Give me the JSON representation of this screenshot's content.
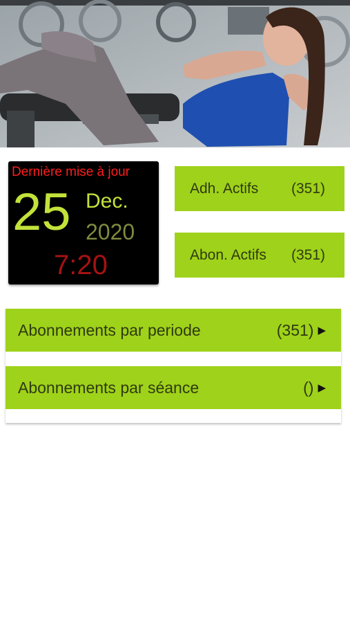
{
  "last_update": {
    "label": "Dernière mise à jour",
    "day": "25",
    "month": "Dec.",
    "year": "2020",
    "time": "7:20"
  },
  "stats": [
    {
      "label": "Adh. Actifs",
      "count": "(351)"
    },
    {
      "label": "Abon. Actifs",
      "count": "(351)"
    }
  ],
  "subscriptions": [
    {
      "label": "Abonnements par periode",
      "count": "(351)",
      "icon": "arrow-right-icon"
    },
    {
      "label": "Abonnements par séance",
      "count": "()",
      "icon": "arrow-right-icon"
    }
  ],
  "colors": {
    "accent_green": "#9fd21a",
    "update_label_red": "#ff1d1d",
    "date_green": "#c2e23a",
    "time_red": "#a51212"
  }
}
